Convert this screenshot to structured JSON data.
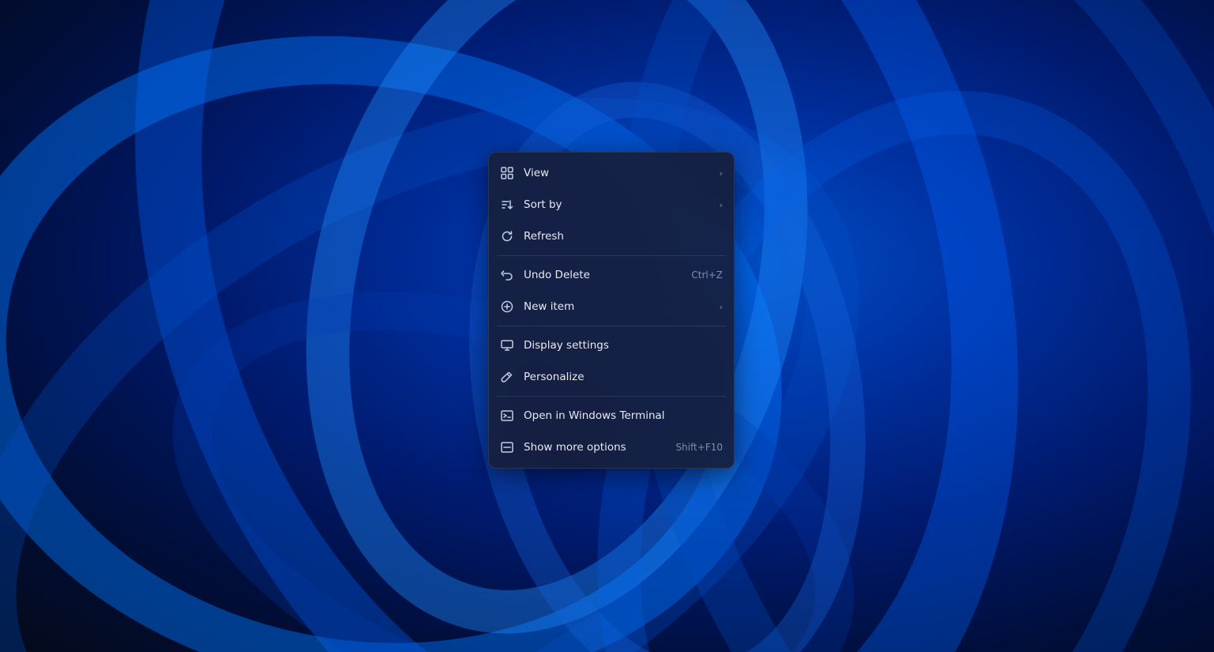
{
  "desktop": {
    "background_description": "Windows 11 blue ribbon wallpaper"
  },
  "context_menu": {
    "items": [
      {
        "id": "view",
        "label": "View",
        "icon": "grid-icon",
        "has_submenu": true,
        "shortcut": "",
        "divider_after": false
      },
      {
        "id": "sort-by",
        "label": "Sort by",
        "icon": "sort-icon",
        "has_submenu": true,
        "shortcut": "",
        "divider_after": false
      },
      {
        "id": "refresh",
        "label": "Refresh",
        "icon": "refresh-icon",
        "has_submenu": false,
        "shortcut": "",
        "divider_after": true
      },
      {
        "id": "undo-delete",
        "label": "Undo Delete",
        "icon": "undo-icon",
        "has_submenu": false,
        "shortcut": "Ctrl+Z",
        "divider_after": false
      },
      {
        "id": "new-item",
        "label": "New item",
        "icon": "plus-circle-icon",
        "has_submenu": true,
        "shortcut": "",
        "divider_after": true
      },
      {
        "id": "display-settings",
        "label": "Display settings",
        "icon": "display-icon",
        "has_submenu": false,
        "shortcut": "",
        "divider_after": false
      },
      {
        "id": "personalize",
        "label": "Personalize",
        "icon": "brush-icon",
        "has_submenu": false,
        "shortcut": "",
        "divider_after": true
      },
      {
        "id": "open-terminal",
        "label": "Open in Windows Terminal",
        "icon": "terminal-icon",
        "has_submenu": false,
        "shortcut": "",
        "divider_after": false
      },
      {
        "id": "show-more",
        "label": "Show more options",
        "icon": "more-icon",
        "has_submenu": false,
        "shortcut": "Shift+F10",
        "divider_after": false
      }
    ]
  }
}
